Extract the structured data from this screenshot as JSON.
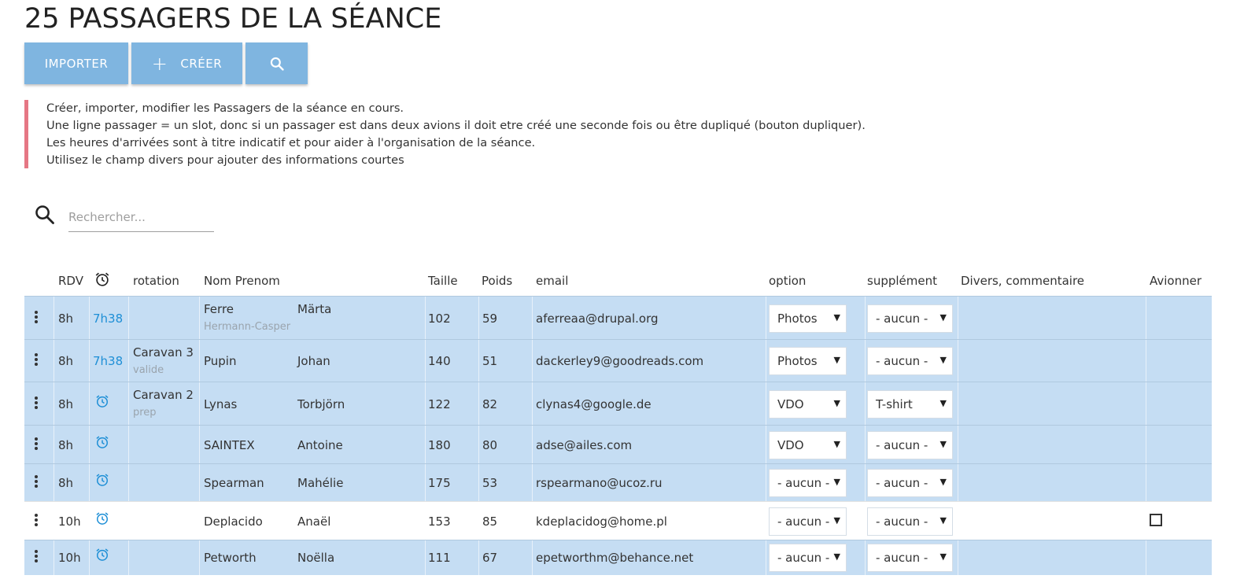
{
  "page": {
    "title": "25 PASSAGERS DE LA SÉANCE",
    "buttons": {
      "import": "IMPORTER",
      "create": "CRÉER"
    },
    "info_lines": [
      "Créer, importer, modifier les Passagers de la séance en cours.",
      "Une ligne passager = un slot, donc si un passager est dans deux avions il doit etre créé une seconde fois ou être dupliqué (bouton dupliquer).",
      "Les heures d'arrivées sont à titre indicatif et pour aider à l'organisation de la séance.",
      "Utilisez le champ divers pour ajouter des informations courtes"
    ],
    "search": {
      "placeholder": "Rechercher..."
    }
  },
  "colors": {
    "button": "#7fb5e0",
    "row_bg": "#c5ddf3",
    "info_border": "#e57784",
    "link": "#1e8fd6"
  },
  "table": {
    "headers": {
      "rdv": "RDV",
      "rotation": "rotation",
      "nom_prenom": "Nom Prenom",
      "taille": "Taille",
      "poids": "Poids",
      "email": "email",
      "option": "option",
      "supplement": "supplément",
      "divers": "Divers, commentaire",
      "avionner": "Avionner"
    },
    "rows": [
      {
        "rdv": "8h",
        "time": "7h38",
        "rotation": "",
        "rotation_status": "",
        "nom": "Ferre",
        "nom_sub": "Hermann-Casper",
        "prenom": "Märta",
        "taille": "102",
        "poids": "59",
        "email": "aferreaa@drupal.org",
        "option": "Photos",
        "supplement": "- aucun -",
        "highlight": true
      },
      {
        "rdv": "8h",
        "time": "7h38",
        "rotation": "Caravan 3",
        "rotation_status": "valide",
        "nom": "Pupin",
        "nom_sub": "",
        "prenom": "Johan",
        "taille": "140",
        "poids": "51",
        "email": "dackerley9@goodreads.com",
        "option": "Photos",
        "supplement": "- aucun -",
        "highlight": true
      },
      {
        "rdv": "8h",
        "time": "",
        "rotation": "Caravan 2",
        "rotation_status": "prep",
        "nom": "Lynas",
        "nom_sub": "",
        "prenom": "Torbjörn",
        "taille": "122",
        "poids": "82",
        "email": "clynas4@google.de",
        "option": "VDO",
        "supplement": "T-shirt",
        "highlight": true
      },
      {
        "rdv": "8h",
        "time": "",
        "rotation": "",
        "rotation_status": "",
        "nom": "SAINTEX",
        "nom_sub": "",
        "prenom": "Antoine",
        "taille": "180",
        "poids": "80",
        "email": "adse@ailes.com",
        "option": "VDO",
        "supplement": "- aucun -",
        "highlight": true
      },
      {
        "rdv": "8h",
        "time": "",
        "rotation": "",
        "rotation_status": "",
        "nom": "Spearman",
        "nom_sub": "",
        "prenom": "Mahélie",
        "taille": "175",
        "poids": "53",
        "email": "rspearmano@ucoz.ru",
        "option": "- aucun -",
        "supplement": "- aucun -",
        "highlight": true
      },
      {
        "rdv": "10h",
        "time": "",
        "rotation": "",
        "rotation_status": "",
        "nom": "Deplacido",
        "nom_sub": "",
        "prenom": "Anaël",
        "taille": "153",
        "poids": "85",
        "email": "kdeplacidog@home.pl",
        "option": "- aucun -",
        "supplement": "- aucun -",
        "highlight": false
      },
      {
        "rdv": "10h",
        "time": "",
        "rotation": "",
        "rotation_status": "",
        "nom": "Petworth",
        "nom_sub": "",
        "prenom": "Noëlla",
        "taille": "111",
        "poids": "67",
        "email": "epetworthm@behance.net",
        "option": "- aucun -",
        "supplement": "- aucun -",
        "highlight": true
      }
    ]
  }
}
